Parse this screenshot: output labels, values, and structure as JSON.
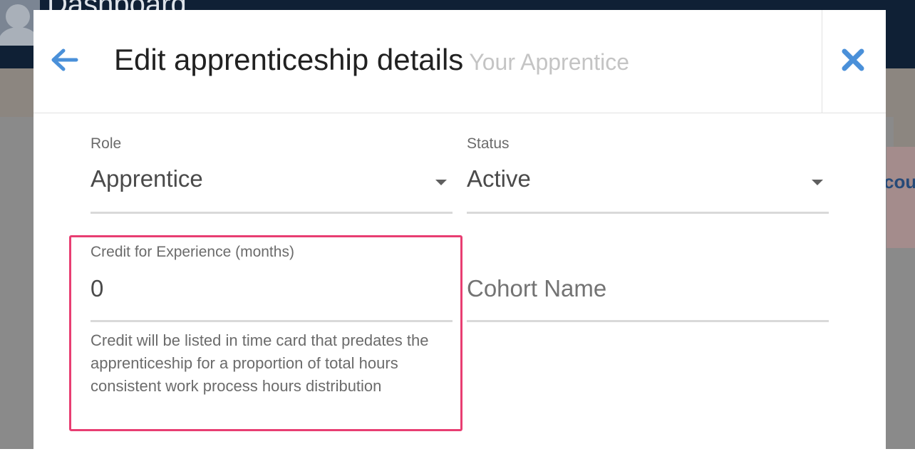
{
  "background": {
    "page_title": "Dashboard",
    "alert_text": "cou"
  },
  "modal": {
    "title": "Edit apprenticeship details",
    "subtitle": "Your Apprentice",
    "back_icon": "arrow-left-icon",
    "close_icon": "close-icon",
    "colors": {
      "accent": "#4a90d9",
      "highlight": "#e83e72"
    }
  },
  "form": {
    "role": {
      "label": "Role",
      "value": "Apprentice"
    },
    "status": {
      "label": "Status",
      "value": "Active"
    },
    "credit": {
      "label": "Credit for Experience (months)",
      "value": "0",
      "helper": "Credit will be listed in time card that predates the apprenticeship for a proportion of total hours consistent work process hours distribution"
    },
    "cohort": {
      "placeholder": "Cohort Name",
      "value": ""
    }
  }
}
